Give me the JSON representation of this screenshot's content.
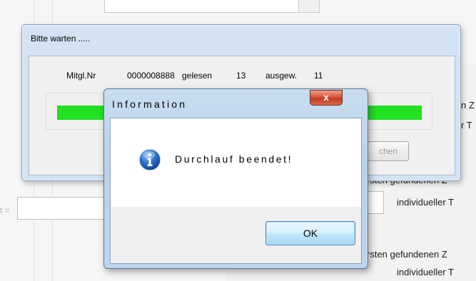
{
  "background": {
    "label_rest_top": "n Z",
    "label_rest_mid": "r T",
    "label_partial_left": "t =",
    "label_found_1": "rsten gefundenen Z",
    "label_individual_1": "individueller T",
    "label_found_2": "rsten gefundenen Z",
    "label_individual_2": "individueller T"
  },
  "wait_dialog": {
    "title": "Bitte warten .....",
    "record_label": "Mitgl.Nr",
    "record_number": "0000008888",
    "read_label": "gelesen",
    "read_count": "13",
    "selected_label": "ausgew.",
    "selected_count": "11",
    "progress_fraction": 1.0,
    "cancel_label_partial": "chen",
    "progress_color": "#22e022"
  },
  "info_dialog": {
    "title": "Information",
    "close_label": "x",
    "icon": "info-icon",
    "message": "Durchlauf beendet!",
    "ok_label": "OK"
  }
}
